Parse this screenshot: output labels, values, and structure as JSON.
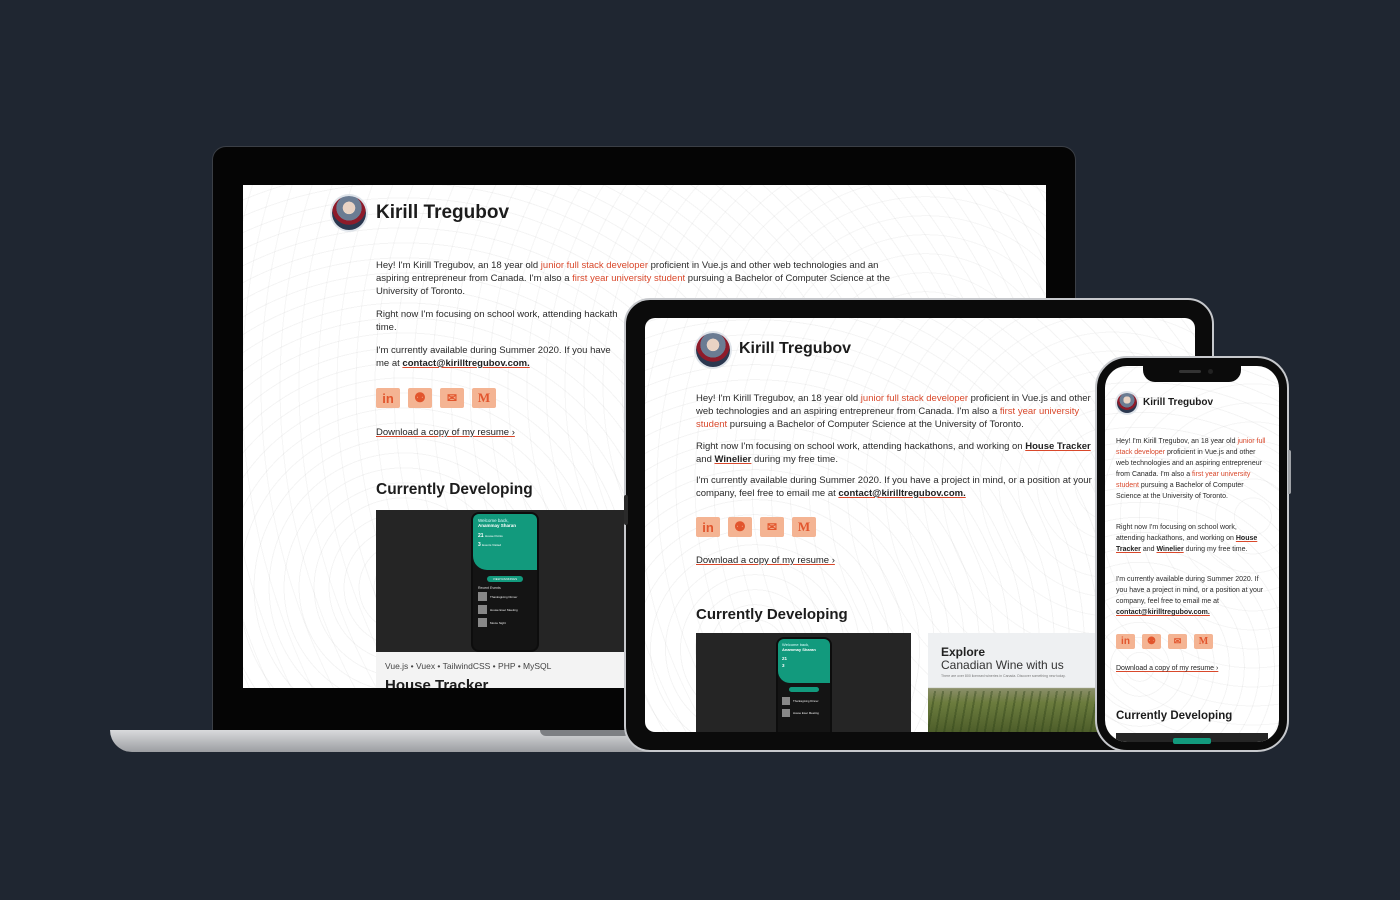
{
  "profile": {
    "name": "Kirill Tregubov",
    "intro_start": "Hey! I'm Kirill Tregubov, an 18 year old ",
    "intro_link1": "junior full stack developer",
    "intro_mid": " proficient in Vue.js and other web technologies and an aspiring entrepreneur from Canada. I'm also a ",
    "intro_link2": "first year university student",
    "intro_end": " pursuing a Bachelor of Computer Science at the University of Toronto.",
    "focus_start": "Right now I'm focusing on school work, attending hackathons, and working on ",
    "focus_link1": "House Tracker",
    "focus_and": " and ",
    "focus_link2": "Winelier",
    "focus_end": " during my free time.",
    "avail_start": "I'm currently available during Summer 2020. If you have a project in mind, or a position at your company, feel free to email me at ",
    "email": "contact@kirilltregubov.com.",
    "resume_link": "Download a copy of my resume ›",
    "section_title": "Currently Developing",
    "social": [
      "in",
      "⚉",
      "✉",
      "M"
    ],
    "social_names": [
      "linkedin-icon",
      "github-icon",
      "twitter-icon",
      "medium-icon"
    ]
  },
  "laptop": {
    "intro_line1_start": "Hey! I'm Kirill Tregubov, an 18 year old ",
    "intro_line1_end": " proficient in Vue.js and other web technologies and an",
    "intro_line2_start": "aspiring entrepreneur from Canada. I'm also a ",
    "intro_line2_end": " pursuing a Bachelor of Computer Science at the",
    "intro_line3": "University of Toronto.",
    "focus_line1": "Right now I'm focusing on school work, attending hackath",
    "focus_line2": "time.",
    "avail_line1": "I'm currently available during Summer 2020. If you have",
    "avail_line2": "me at ",
    "tech_stack": "Vue.js • Vuex • TailwindCSS • PHP • MySQL",
    "project_title": "House Tracker"
  },
  "app_preview": {
    "welcome": "Welcome back,",
    "user": "Anammay Sharan",
    "stat1_num": "21",
    "stat1_label": "House Points",
    "stat2_num": "3",
    "stat2_label": "Events Visited",
    "button": "VIEW RANKINGS",
    "recent": "Recent Events",
    "events": [
      "Thanksgiving Dinner",
      "House Exec Meeting",
      "Movie Night"
    ]
  },
  "winelier": {
    "title": "Explore",
    "subtitle": "Canadian Wine with us",
    "caption": "There are over 800 licensed wineries in Canada. Discover something new today."
  }
}
